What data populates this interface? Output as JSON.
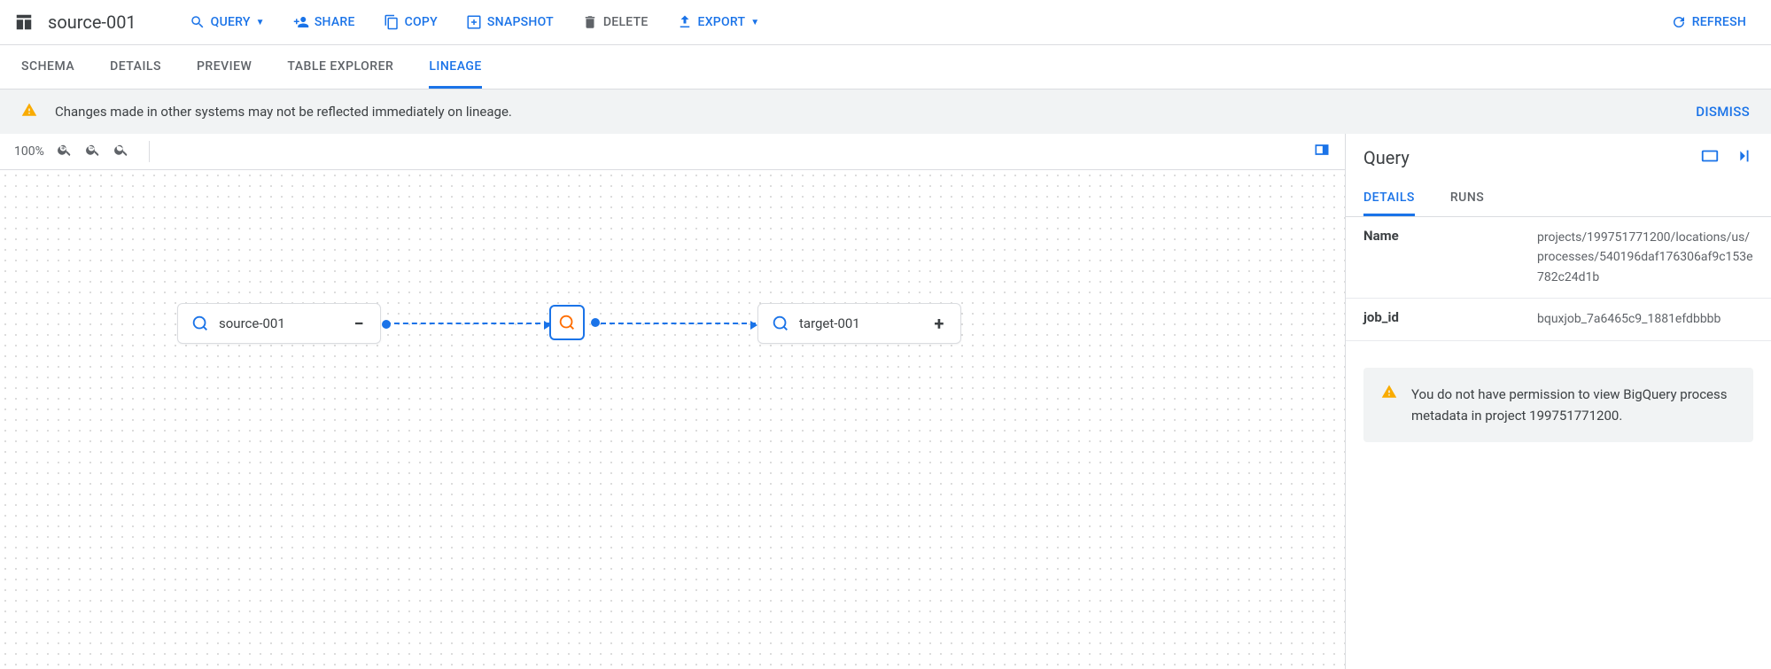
{
  "header": {
    "title": "source-001",
    "actions": {
      "query": "QUERY",
      "share": "SHARE",
      "copy": "COPY",
      "snapshot": "SNAPSHOT",
      "delete": "DELETE",
      "export": "EXPORT",
      "refresh": "REFRESH"
    }
  },
  "tabs": {
    "schema": "SCHEMA",
    "details": "DETAILS",
    "preview": "PREVIEW",
    "table_explorer": "TABLE EXPLORER",
    "lineage": "LINEAGE"
  },
  "banner": {
    "text": "Changes made in other systems may not be reflected immediately on lineage.",
    "dismiss": "DISMISS"
  },
  "canvas": {
    "zoom": "100%",
    "nodes": {
      "source": "source-001",
      "target": "target-001"
    }
  },
  "side": {
    "title": "Query",
    "tabs": {
      "details": "DETAILS",
      "runs": "RUNS"
    },
    "rows": {
      "name_key": "Name",
      "name_val": "projects/199751771200/locations/us/processes/540196daf176306af9c153e782c24d1b",
      "job_key": "job_id",
      "job_val": "bquxjob_7a6465c9_1881efdbbbb"
    },
    "perm_warning": "You do not have permission to view BigQuery process metadata in project 199751771200."
  }
}
